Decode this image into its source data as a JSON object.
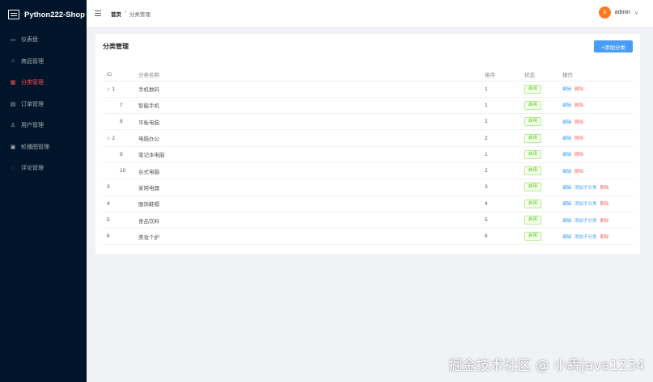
{
  "app": {
    "title": "Python222-Shop"
  },
  "sidebar": {
    "items": [
      {
        "label": "仪表盘",
        "icon": "dashboard-icon",
        "glyph": "▭",
        "active": false
      },
      {
        "label": "商品管理",
        "icon": "bag-icon",
        "glyph": "⌂",
        "active": false
      },
      {
        "label": "分类管理",
        "icon": "category-icon",
        "glyph": "▦",
        "active": true
      },
      {
        "label": "订单管理",
        "icon": "order-icon",
        "glyph": "▤",
        "active": false
      },
      {
        "label": "用户管理",
        "icon": "user-icon",
        "glyph": "♙",
        "active": false
      },
      {
        "label": "轮播图管理",
        "icon": "image-icon",
        "glyph": "▣",
        "active": false
      },
      {
        "label": "评论管理",
        "icon": "comment-icon",
        "glyph": "◌",
        "active": false
      }
    ]
  },
  "header": {
    "breadcrumb_home": "首页",
    "breadcrumb_sep": "/",
    "breadcrumb_current": "分类管理",
    "user_initial": "A",
    "user_name": "admin",
    "user_chevron": "∨"
  },
  "card": {
    "title": "分类管理",
    "add_button": "+添加分类"
  },
  "table": {
    "columns": [
      "ID",
      "分类名称",
      "排序",
      "状态",
      "操作"
    ],
    "rows": [
      {
        "caret": "∨",
        "id": "1",
        "name": "手机数码",
        "sort": "1",
        "status": "启用",
        "actions": [
          "编辑",
          "删除"
        ],
        "child": false
      },
      {
        "caret": "",
        "id": "7",
        "name": "智能手机",
        "sort": "1",
        "status": "启用",
        "actions": [
          "编辑",
          "删除"
        ],
        "child": true
      },
      {
        "caret": "",
        "id": "8",
        "name": "平板电脑",
        "sort": "2",
        "status": "启用",
        "actions": [
          "编辑",
          "删除"
        ],
        "child": true
      },
      {
        "caret": "∨",
        "id": "2",
        "name": "电脑办公",
        "sort": "2",
        "status": "启用",
        "actions": [
          "编辑",
          "删除"
        ],
        "child": false
      },
      {
        "caret": "",
        "id": "9",
        "name": "笔记本电脑",
        "sort": "1",
        "status": "启用",
        "actions": [
          "编辑",
          "删除"
        ],
        "child": true
      },
      {
        "caret": "",
        "id": "10",
        "name": "台式电脑",
        "sort": "2",
        "status": "启用",
        "actions": [
          "编辑",
          "删除"
        ],
        "child": true
      },
      {
        "caret": "",
        "id": "3",
        "name": "家用电器",
        "sort": "3",
        "status": "启用",
        "actions": [
          "编辑",
          "添加子分类",
          "删除"
        ],
        "child": false
      },
      {
        "caret": "",
        "id": "4",
        "name": "服饰鞋帽",
        "sort": "4",
        "status": "启用",
        "actions": [
          "编辑",
          "添加子分类",
          "删除"
        ],
        "child": false
      },
      {
        "caret": "",
        "id": "5",
        "name": "食品饮料",
        "sort": "5",
        "status": "启用",
        "actions": [
          "编辑",
          "添加子分类",
          "删除"
        ],
        "child": false
      },
      {
        "caret": "",
        "id": "6",
        "name": "美妆个护",
        "sort": "6",
        "status": "启用",
        "actions": [
          "编辑",
          "添加子分类",
          "删除"
        ],
        "child": false
      }
    ]
  },
  "watermark": "掘金技术社区 @ 小犇java1234",
  "colors": {
    "sidebar_bg": "#001529",
    "accent": "#409eff",
    "active_menu": "#ff4d4f",
    "danger": "#f56c6c",
    "success": "#52c41a",
    "avatar": "#ff7a22"
  }
}
